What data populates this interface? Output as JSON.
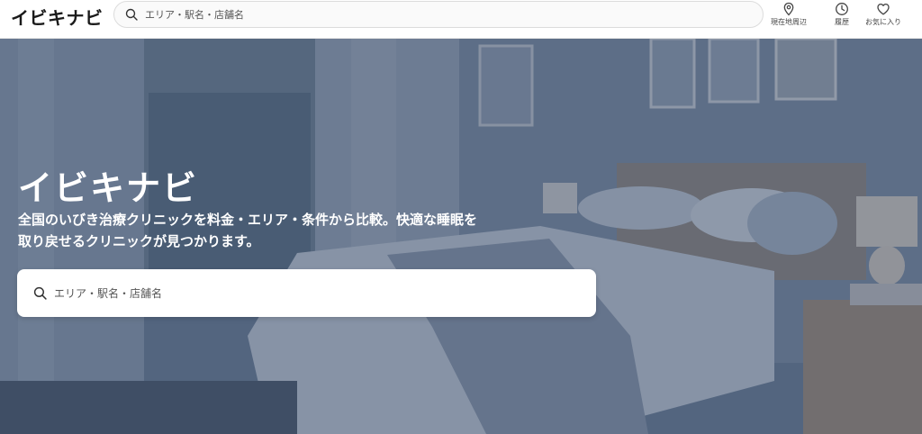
{
  "header": {
    "logo": "イビキナビ",
    "search_placeholder": "エリア・駅名・店舗名",
    "nav": [
      {
        "label": "現在地周辺",
        "icon": "location-pin-icon"
      },
      {
        "label": "履歴",
        "icon": "clock-icon"
      },
      {
        "label": "お気に入り",
        "icon": "heart-icon"
      }
    ]
  },
  "hero": {
    "title": "イビキナビ",
    "description_line1": "全国のいびき治療クリニックを料金・エリア・条件から比較。快適な睡眠を",
    "description_line2": "取り戻せるクリニックが見つかります。",
    "search_placeholder": "エリア・駅名・店舗名",
    "background": "bedroom-photo"
  },
  "colors": {
    "header_bg": "#ffffff",
    "hero_overlay": "#1e2d4b",
    "text_on_hero": "#ffffff"
  }
}
